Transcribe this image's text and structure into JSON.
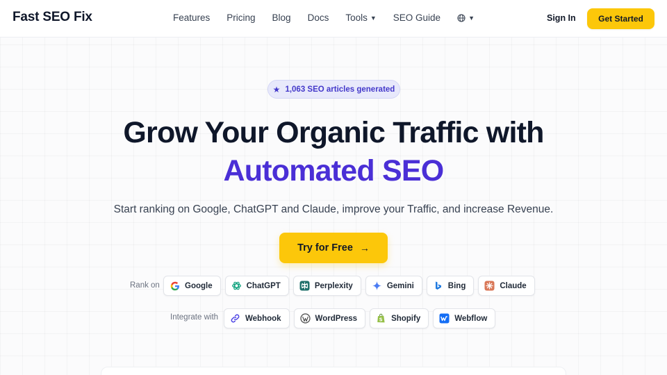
{
  "nav": {
    "brand": "Fast SEO Fix",
    "links": [
      "Features",
      "Pricing",
      "Blog",
      "Docs",
      "Tools",
      "SEO Guide"
    ],
    "sign_in": "Sign In",
    "get_started": "Get Started"
  },
  "hero": {
    "badge": "1,063 SEO articles generated",
    "headline_line1": "Grow Your Organic Traffic with",
    "headline_line2": "Automated SEO",
    "subtext": "Start ranking on Google, ChatGPT and Claude, improve your Traffic, and increase Revenue.",
    "cta": "Try for Free"
  },
  "rank_on": {
    "label": "Rank on",
    "items": [
      "Google",
      "ChatGPT",
      "Perplexity",
      "Gemini",
      "Bing",
      "Claude"
    ]
  },
  "integrate_with": {
    "label": "Integrate with",
    "items": [
      "Webhook",
      "WordPress",
      "Shopify",
      "Webflow"
    ]
  },
  "colors": {
    "accent_yellow": "#fcc70a",
    "accent_purple": "#4a2fd6",
    "badge_bg": "#e8e9fb"
  }
}
